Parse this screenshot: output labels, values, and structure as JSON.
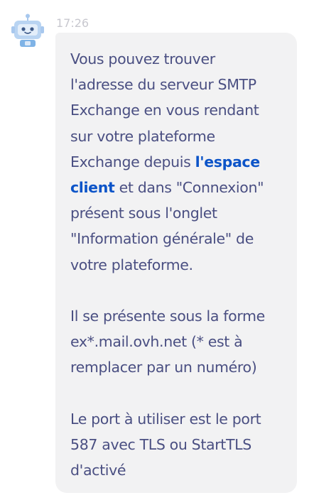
{
  "message": {
    "timestamp": "17:26",
    "paragraph1": {
      "line1": "Vous pouvez trouver",
      "line2": "l'adresse du serveur SMTP",
      "line3": "Exchange en vous rendant",
      "line4": "sur votre plateforme",
      "line5_before_link": "Exchange depuis ",
      "link_part1": "l'espace",
      "link_part2": "client",
      "line6_after_link": " et dans \"Connexion\"",
      "line7": "présent sous l'onglet",
      "line8": "\"Information générale\" de",
      "line9": "votre plateforme."
    },
    "paragraph2": {
      "line1": "Il se présente sous la forme",
      "line2": "ex*.mail.ovh.net (* est à",
      "line3": "remplacer par un numéro)"
    },
    "paragraph3": {
      "line1": "Le port à utiliser est le port",
      "line2": "587 avec TLS ou StartTLS",
      "line3": "d'activé"
    }
  },
  "colors": {
    "text": "#4a4f82",
    "link": "#0c54c8",
    "bubble": "#f2f2f3",
    "timestamp": "#c8c8cf",
    "avatar_accent": "#7fb3e6"
  },
  "icons": {
    "avatar": "robot-avatar-icon"
  }
}
